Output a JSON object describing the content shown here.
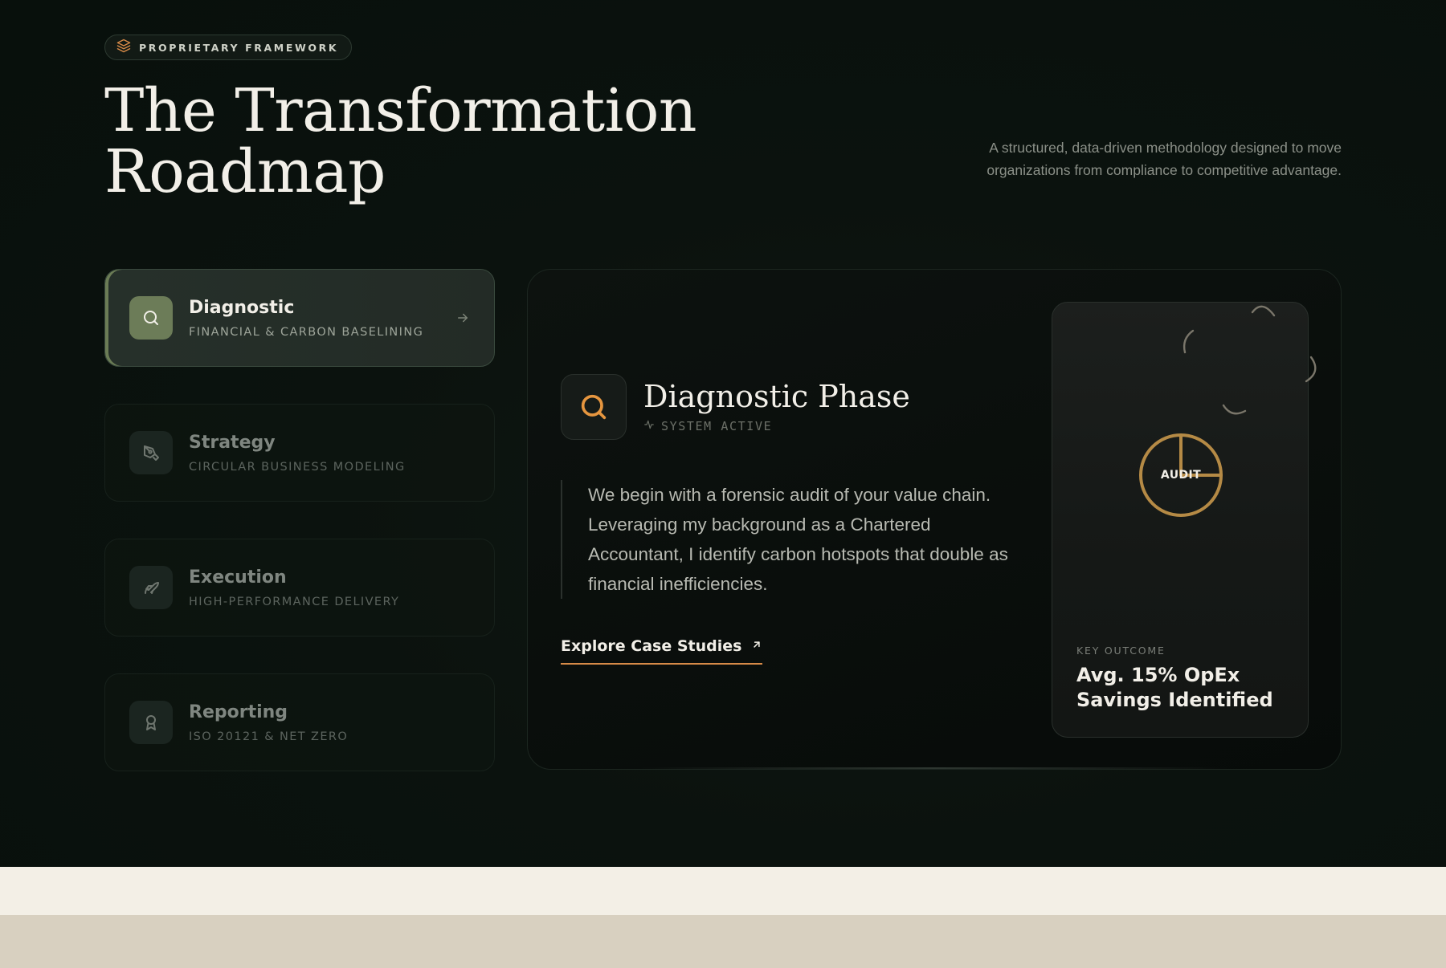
{
  "badge": {
    "icon": "layers-icon",
    "label": "PROPRIETARY FRAMEWORK",
    "accent": "#d68a48"
  },
  "hero": {
    "title_line1": "The Transformation",
    "title_line2": "Roadmap",
    "subtitle": "A structured, data-driven methodology designed to move organizations from compliance to competitive advantage."
  },
  "phases": [
    {
      "title": "Diagnostic",
      "subtitle": "FINANCIAL & CARBON BASELINING",
      "icon": "search-icon",
      "active": true
    },
    {
      "title": "Strategy",
      "subtitle": "CIRCULAR BUSINESS MODELING",
      "icon": "pen-tool-icon",
      "active": false
    },
    {
      "title": "Execution",
      "subtitle": "HIGH-PERFORMANCE DELIVERY",
      "icon": "rocket-icon",
      "active": false
    },
    {
      "title": "Reporting",
      "subtitle": "ISO 20121 & NET ZERO",
      "icon": "award-icon",
      "active": false
    }
  ],
  "detail": {
    "icon": "search-icon",
    "heading": "Diagnostic Phase",
    "status": "SYSTEM ACTIVE",
    "description": "We begin with a forensic audit of your value chain. Leveraging my background as a Chartered Accountant, I identify carbon hotspots that double as financial inefficiencies.",
    "cta_label": "Explore Case Studies",
    "cta_icon": "arrow-up-right-icon"
  },
  "outcome": {
    "chart_label": "AUDIT",
    "kicker": "KEY OUTCOME",
    "value": "Avg. 15% OpEx Savings Identified"
  },
  "colors": {
    "background": "#0b120e",
    "accent_orange": "#d68a48",
    "accent_gold": "#b58a45",
    "active_green": "#6c7c58",
    "cream": "#f3efe6",
    "beige": "#d8d0c0"
  }
}
